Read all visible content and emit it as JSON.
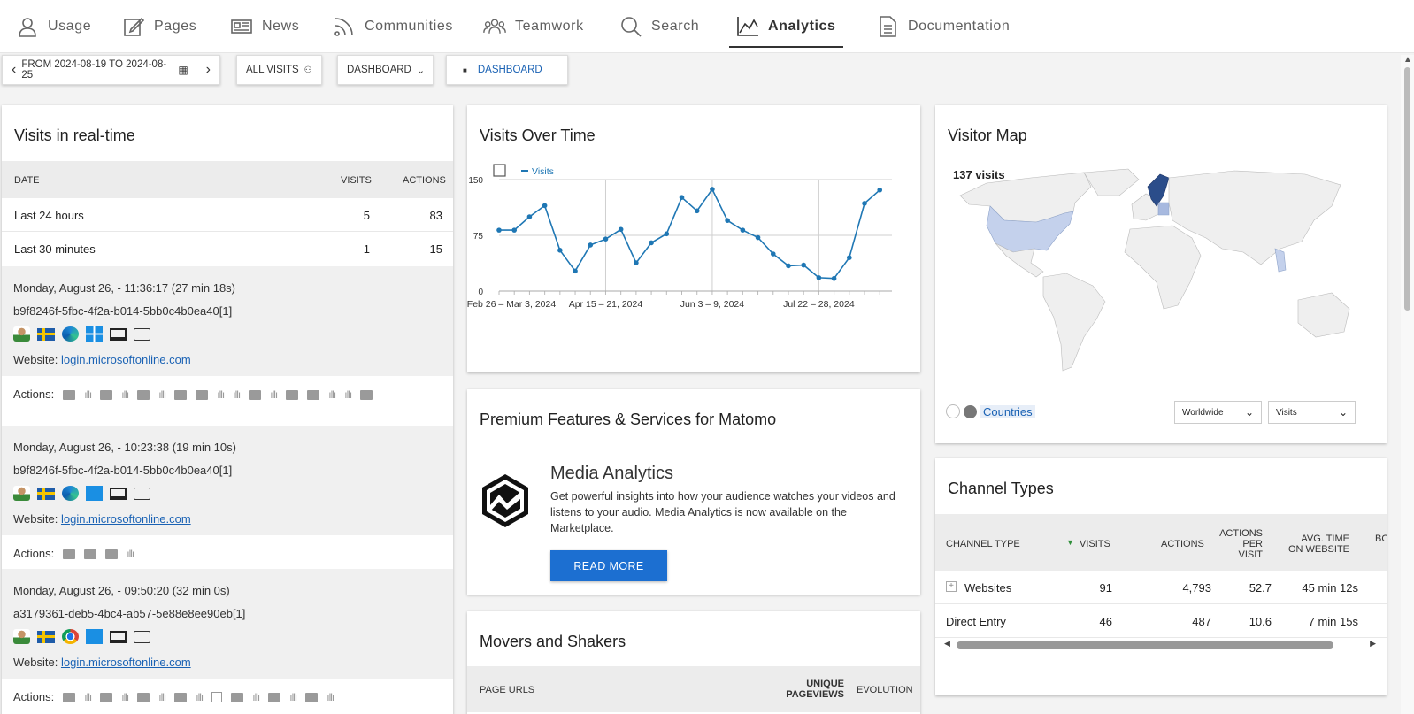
{
  "nav": {
    "items": [
      {
        "label": "Usage",
        "icon": "user-icon"
      },
      {
        "label": "Pages",
        "icon": "pencil-icon"
      },
      {
        "label": "News",
        "icon": "newspaper-icon"
      },
      {
        "label": "Communities",
        "icon": "rss-icon"
      },
      {
        "label": "Teamwork",
        "icon": "people-icon"
      },
      {
        "label": "Search",
        "icon": "search-icon"
      },
      {
        "label": "Analytics",
        "icon": "chart-icon",
        "active": true
      },
      {
        "label": "Documentation",
        "icon": "document-icon"
      }
    ]
  },
  "toolbar": {
    "date_range": "FROM 2024-08-19 TO 2024-08-25",
    "segment": "ALL VISITS",
    "dashboard": "DASHBOARD",
    "dashboard_link": "DASHBOARD"
  },
  "realtime": {
    "title": "Visits in real-time",
    "columns": [
      "DATE",
      "VISITS",
      "ACTIONS"
    ],
    "rows": [
      {
        "label": "Last 24 hours",
        "visits": "5",
        "actions": "83"
      },
      {
        "label": "Last 30 minutes",
        "visits": "1",
        "actions": "15"
      }
    ],
    "visits": [
      {
        "time": "Monday, August 26, - 11:36:17 (27 min 18s)",
        "id": "b9f8246f-5fbc-4f2a-b014-5bb0c4b0ea40[1]",
        "website_label": "Website:",
        "website": "login.microsoftonline.com",
        "browser": "edge",
        "actions_label": "Actions:"
      },
      {
        "time": "Monday, August 26, - 10:23:38 (19 min 10s)",
        "id": "b9f8246f-5fbc-4f2a-b014-5bb0c4b0ea40[1]",
        "website_label": "Website:",
        "website": "login.microsoftonline.com",
        "browser": "edge",
        "actions_label": "Actions:"
      },
      {
        "time": "Monday, August 26, - 09:50:20 (32 min 0s)",
        "id": "a3179361-deb5-4bc4-ab57-5e88e8ee90eb[1]",
        "website_label": "Website:",
        "website": "login.microsoftonline.com",
        "browser": "chrome",
        "actions_label": "Actions:"
      }
    ]
  },
  "visits_over_time": {
    "title": "Visits Over Time",
    "legend": "Visits"
  },
  "chart_data": {
    "type": "line",
    "title": "Visits Over Time",
    "series": [
      {
        "name": "Visits",
        "values": [
          82,
          82,
          100,
          115,
          55,
          27,
          62,
          70,
          83,
          38,
          65,
          77,
          126,
          108,
          137,
          95,
          82,
          72,
          50,
          34,
          35,
          18,
          17,
          45,
          118,
          136
        ]
      }
    ],
    "x_tick_labels": [
      "Feb 26 – Mar 3, 2024",
      "Apr 15 – 21, 2024",
      "Jun 3 – 9, 2024",
      "Jul 22 – 28, 2024"
    ],
    "y_tick_labels": [
      "150",
      "75",
      "0"
    ],
    "ylim": [
      0,
      150
    ],
    "grid": true,
    "legend": "top-left"
  },
  "premium": {
    "title": "Premium Features & Services for Matomo",
    "product_title": "Media Analytics",
    "text": "Get powerful insights into how your audience watches your videos and listens to your audio. Media Analytics is now available on the Marketplace.",
    "button": "READ MORE"
  },
  "movers": {
    "title": "Movers and Shakers",
    "columns": [
      "PAGE URLS",
      "UNIQUE PAGEVIEWS",
      "EVOLUTION"
    ]
  },
  "visitor_map": {
    "title": "Visitor Map",
    "summary": "137 visits",
    "countries_link": "Countries",
    "region_select": "Worldwide",
    "metric_select": "Visits",
    "colors": {
      "sweden": "#2b4d8a",
      "usa": "#c4d1ec",
      "land": "#efefef"
    }
  },
  "channel_types": {
    "title": "Channel Types",
    "columns": [
      "CHANNEL TYPE",
      "VISITS",
      "ACTIONS",
      "ACTIONS PER VISIT",
      "AVG. TIME ON WEBSITE",
      "BO"
    ],
    "rows": [
      {
        "type": "Websites",
        "visits": "91",
        "actions": "4,793",
        "apv": "52.7",
        "avg_time": "45 min 12s"
      },
      {
        "type": "Direct Entry",
        "visits": "46",
        "actions": "487",
        "apv": "10.6",
        "avg_time": "7 min 15s"
      }
    ]
  }
}
